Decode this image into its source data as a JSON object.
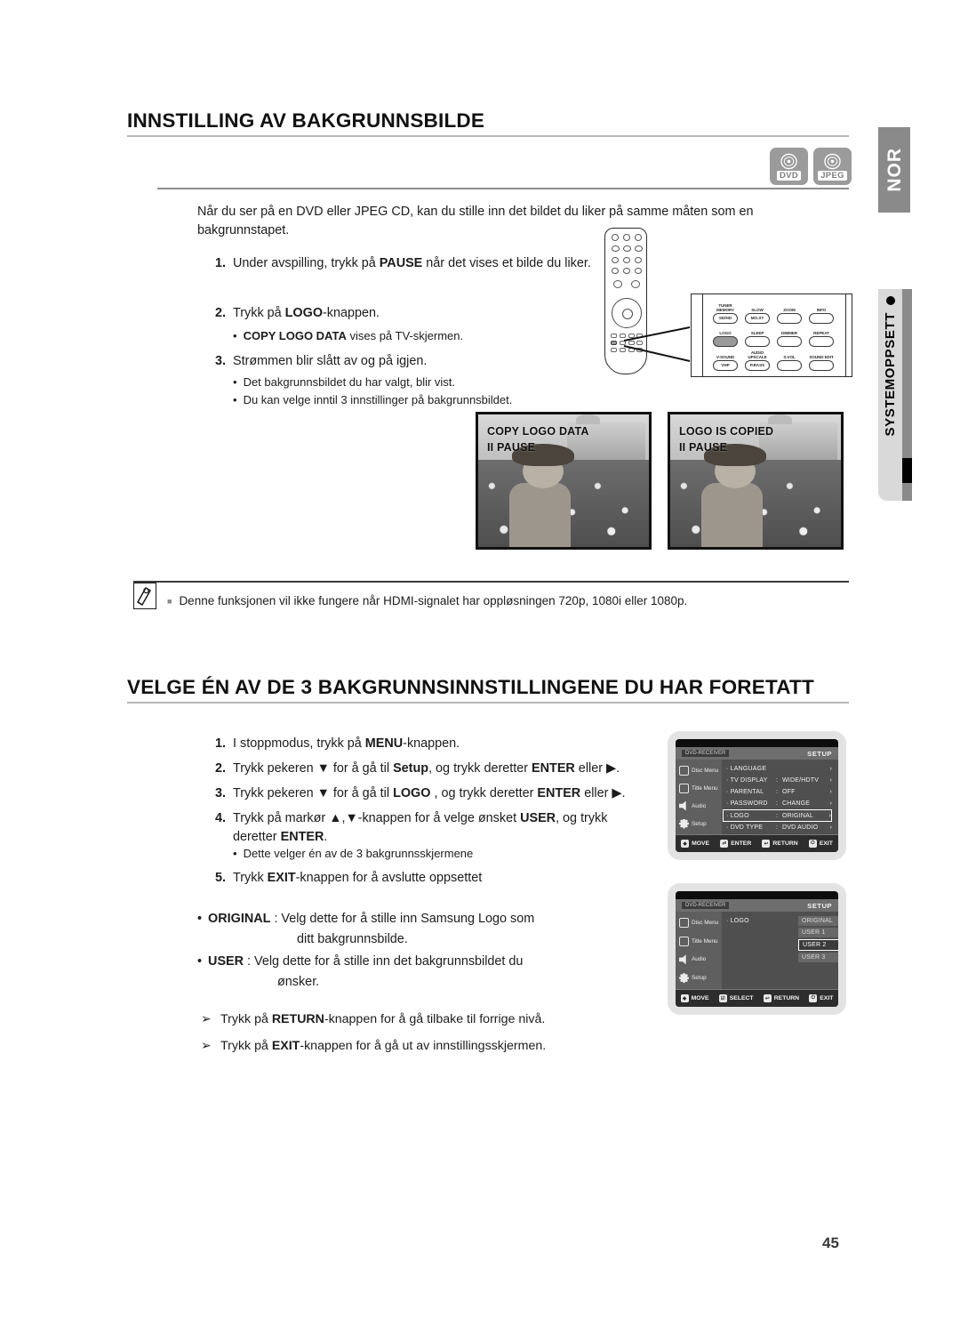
{
  "side": {
    "language_tab": "NOR",
    "chapter_label": "SYSTEMOPPSETT"
  },
  "section1": {
    "heading": "INNSTILLING AV BAKGRUNNSBILDE",
    "badges": [
      {
        "name": "DVD",
        "icon": "disc-icon"
      },
      {
        "name": "JPEG",
        "icon": "disc-icon"
      }
    ],
    "intro": "Når du ser på en DVD eller JPEG CD, kan du stille inn det bildet du liker på samme måten som en bakgrunnstapet.",
    "steps": [
      {
        "num": "1.",
        "pre": "Under avspilling, trykk på ",
        "bold": "PAUSE",
        "post": " når det vises et bilde du liker."
      },
      {
        "num": "2.",
        "pre": "Trykk på ",
        "bold": "LOGO",
        "post": "-knappen."
      },
      {
        "num": "3.",
        "pre": "Strømmen blir slått av og på igjen.",
        "bold": "",
        "post": ""
      }
    ],
    "sub_step2": {
      "bold": "COPY LOGO DATA",
      "rest": " vises på TV-skjermen."
    },
    "sub_step3": [
      "Det bakgrunnsbildet du har valgt, blir vist.",
      "Du kan velge inntil 3 innstillinger på bakgrunnsbildet."
    ],
    "photos": [
      {
        "line1": "COPY LOGO DATA",
        "line2": "II PAUSE"
      },
      {
        "line1": "LOGO IS COPIED",
        "line2": "II PAUSE"
      }
    ],
    "note": "Denne funksjonen vil ikke fungere når HDMI-signalet har oppløsningen 720p, 1080i eller 1080p."
  },
  "remote": {
    "buttons": [
      {
        "label": "TUNER\nMEMORY",
        "cap": "SD/HD",
        "filled": false
      },
      {
        "label": "SLOW",
        "cap": "MO.ST",
        "filled": false
      },
      {
        "label": "ZOOM",
        "cap": "",
        "filled": false
      },
      {
        "label": "INFO",
        "cap": "",
        "filled": false
      },
      {
        "label": "LOGO",
        "cap": "",
        "filled": true
      },
      {
        "label": "SLEEP",
        "cap": "",
        "filled": false
      },
      {
        "label": "DIMMER",
        "cap": "",
        "filled": false
      },
      {
        "label": "REPEAT",
        "cap": "",
        "filled": false
      },
      {
        "label": "V-SOUND",
        "cap": "VHP",
        "filled": false
      },
      {
        "label": "AUDIO\nUPSCALE",
        "cap": "P.BASS",
        "filled": false
      },
      {
        "label": "S.VOL",
        "cap": "",
        "filled": false
      },
      {
        "label": "SOUND EDIT",
        "cap": "",
        "filled": false
      }
    ]
  },
  "section2": {
    "heading": "VELGE ÉN AV DE 3 BAKGRUNNSINNSTILLINGENE DU HAR FORETATT",
    "steps": [
      {
        "num": "1.",
        "segs": [
          {
            "t": "I stoppmodus, trykk på ",
            "b": false
          },
          {
            "t": "MENU",
            "b": true
          },
          {
            "t": "-knappen.",
            "b": false
          }
        ]
      },
      {
        "num": "2.",
        "segs": [
          {
            "t": "Trykk pekeren ▼  for å gå til ",
            "b": false
          },
          {
            "t": "Setup",
            "b": true
          },
          {
            "t": ", og trykk deretter ",
            "b": false
          },
          {
            "t": "ENTER",
            "b": true
          },
          {
            "t": " eller ▶.",
            "b": false
          }
        ]
      },
      {
        "num": "3.",
        "segs": [
          {
            "t": "Trykk pekeren ▼ for å gå til ",
            "b": false
          },
          {
            "t": "LOGO",
            "b": true
          },
          {
            "t": " , og trykk deretter ",
            "b": false
          },
          {
            "t": "ENTER",
            "b": true
          },
          {
            "t": " eller ▶.",
            "b": false
          }
        ]
      },
      {
        "num": "4.",
        "segs": [
          {
            "t": "Trykk på markør ▲,▼-knappen for å velge ønsket ",
            "b": false
          },
          {
            "t": "USER",
            "b": true
          },
          {
            "t": ", og trykk deretter ",
            "b": false
          },
          {
            "t": "ENTER",
            "b": true
          },
          {
            "t": ".",
            "b": false
          }
        ]
      },
      {
        "num": "5.",
        "segs": [
          {
            "t": "Trykk ",
            "b": false
          },
          {
            "t": "EXIT",
            "b": true
          },
          {
            "t": "-knappen for å avslutte oppsettet",
            "b": false
          }
        ]
      }
    ],
    "sub_step4": "Dette velger én av de 3 bakgrunnsskjermene",
    "options": [
      {
        "name": "ORIGINAL",
        "line1": " : Velg dette for å stille inn Samsung Logo som",
        "line2": "ditt bakgrunnsbilde."
      },
      {
        "name": "USER",
        "line1": " : Velg dette for å stille inn det bakgrunnsbildet du",
        "line2": "ønsker."
      }
    ],
    "arrows": [
      {
        "pre": "Trykk på ",
        "bold": "RETURN",
        "post": "-knappen for å gå tilbake til forrige nivå."
      },
      {
        "pre": "Trykk på ",
        "bold": "EXIT",
        "post": "-knappen for å gå ut av innstillingsskjermen."
      }
    ]
  },
  "osd1": {
    "header_left": "DVD-RECEIVER",
    "header_right": "SETUP",
    "side_items": [
      "Disc Menu",
      "Title Menu",
      "Audio",
      "Setup"
    ],
    "rows": [
      {
        "key": "LANGUAGE",
        "colon": "",
        "value": "",
        "chev": "›"
      },
      {
        "key": "TV DISPLAY",
        "colon": ":",
        "value": "WIDE/HDTV",
        "chev": "›"
      },
      {
        "key": "PARENTAL",
        "colon": ":",
        "value": "OFF",
        "chev": "›"
      },
      {
        "key": "PASSWORD",
        "colon": ":",
        "value": "CHANGE",
        "chev": "›"
      },
      {
        "key": "LOGO",
        "colon": ":",
        "value": "ORIGINAL",
        "chev": "›",
        "selected": true
      },
      {
        "key": "DVD TYPE",
        "colon": ":",
        "value": "DVD AUDIO",
        "chev": "›"
      }
    ],
    "down_arrow": "▼",
    "bottom": [
      {
        "key": "◈",
        "label": "MOVE"
      },
      {
        "key": "⏎",
        "label": "ENTER"
      },
      {
        "key": "↩",
        "label": "RETURN"
      },
      {
        "key": "⏻",
        "label": "EXIT"
      }
    ]
  },
  "osd2": {
    "header_left": "DVD-RECEIVER",
    "header_right": "SETUP",
    "side_items": [
      "Disc Menu",
      "Title Menu",
      "Audio",
      "Setup"
    ],
    "row_key": "LOGO",
    "options": [
      {
        "label": "ORIGINAL",
        "selected": false
      },
      {
        "label": "USER 1",
        "selected": false
      },
      {
        "label": "USER 2",
        "selected": true
      },
      {
        "label": "USER 3",
        "selected": false
      }
    ],
    "bottom": [
      {
        "key": "◈",
        "label": "MOVE"
      },
      {
        "key": "☑",
        "label": "SELECT"
      },
      {
        "key": "↩",
        "label": "RETURN"
      },
      {
        "key": "⏻",
        "label": "EXIT"
      }
    ]
  },
  "footer": {
    "page_number": "45"
  }
}
